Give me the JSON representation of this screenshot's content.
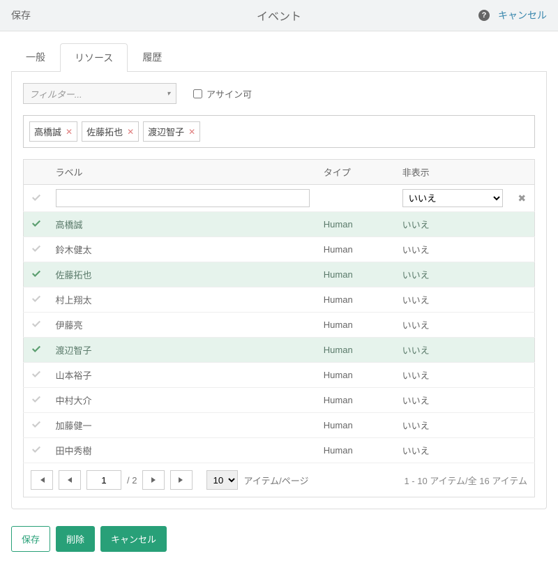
{
  "topbar": {
    "save": "保存",
    "title": "イベント",
    "cancel": "キャンセル"
  },
  "tabs": {
    "general": "一般",
    "resources": "リソース",
    "history": "履歴"
  },
  "filter": {
    "placeholder": "フィルター...",
    "assignable": "アサイン可"
  },
  "tags": [
    "高橋誠",
    "佐藤拓也",
    "渡辺智子"
  ],
  "columns": {
    "label": "ラベル",
    "type": "タイプ",
    "hidden": "非表示"
  },
  "hiddenFilter": {
    "value": "いいえ"
  },
  "rows": [
    {
      "selected": true,
      "label": "高橋誠",
      "type": "Human",
      "hidden": "いいえ"
    },
    {
      "selected": false,
      "label": "鈴木健太",
      "type": "Human",
      "hidden": "いいえ"
    },
    {
      "selected": true,
      "label": "佐藤拓也",
      "type": "Human",
      "hidden": "いいえ"
    },
    {
      "selected": false,
      "label": "村上翔太",
      "type": "Human",
      "hidden": "いいえ"
    },
    {
      "selected": false,
      "label": "伊藤亮",
      "type": "Human",
      "hidden": "いいえ"
    },
    {
      "selected": true,
      "label": "渡辺智子",
      "type": "Human",
      "hidden": "いいえ"
    },
    {
      "selected": false,
      "label": "山本裕子",
      "type": "Human",
      "hidden": "いいえ"
    },
    {
      "selected": false,
      "label": "中村大介",
      "type": "Human",
      "hidden": "いいえ"
    },
    {
      "selected": false,
      "label": "加藤健一",
      "type": "Human",
      "hidden": "いいえ"
    },
    {
      "selected": false,
      "label": "田中秀樹",
      "type": "Human",
      "hidden": "いいえ"
    }
  ],
  "pager": {
    "current": "1",
    "totalPages": "/ 2",
    "perPageValue": "10",
    "perPageLabel": "アイテム/ページ",
    "summary": "1 - 10 アイテム/全 16 アイテム"
  },
  "footer": {
    "save": "保存",
    "delete": "削除",
    "cancel": "キャンセル"
  }
}
